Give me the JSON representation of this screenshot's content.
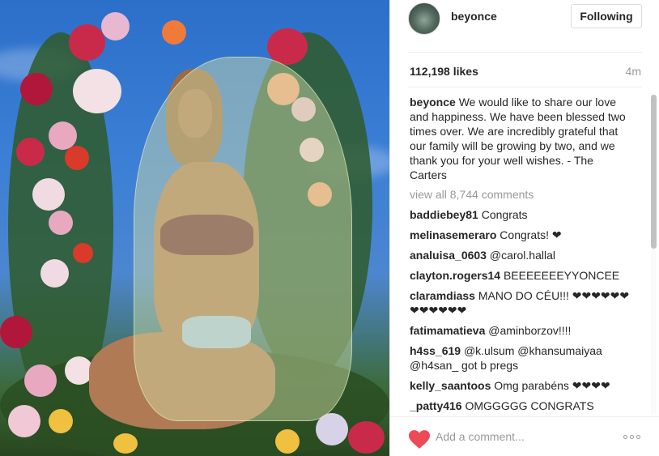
{
  "post": {
    "image_alt": "photo"
  },
  "header": {
    "username": "beyonce",
    "follow_label": "Following"
  },
  "stats": {
    "likes": "112,198 likes",
    "time_ago": "4m"
  },
  "caption": {
    "user": "beyonce",
    "text": "We would like to share our love and happiness. We have been blessed two times over. We are incredibly grateful that our family will be growing by two, and we thank you for your well wishes. - The Carters"
  },
  "view_all": "view all 8,744 comments",
  "comments": [
    {
      "user": "baddiebey81",
      "text": "Congrats"
    },
    {
      "user": "melinasemeraro",
      "text": "Congrats! ❤"
    },
    {
      "user": "analuisa_0603",
      "text": "@carol.hallal"
    },
    {
      "user": "clayton.rogers14",
      "text": "BEEEEEEEYYONCEE"
    },
    {
      "user": "claramdiass",
      "text": "MANO DO CÉU!!! ❤❤❤❤❤❤❤❤❤❤❤❤"
    },
    {
      "user": "fatimamatieva",
      "text": "@aminborzov!!!!"
    },
    {
      "user": "h4ss_619",
      "text": "@k.ulsum @khansumaiyaa @h4san_ got b pregs"
    },
    {
      "user": "kelly_saantoos",
      "text": "Omg parabéns ❤❤❤❤"
    },
    {
      "user": "_patty416",
      "text": "OMGGGGG CONGRATS"
    }
  ],
  "footer": {
    "comment_placeholder": "Add a comment..."
  },
  "colors": {
    "heart": "#ed4956",
    "link": "#003569",
    "muted": "#999999",
    "text": "#262626"
  },
  "icons": {
    "like": "heart-icon",
    "more": "more-options-icon"
  }
}
